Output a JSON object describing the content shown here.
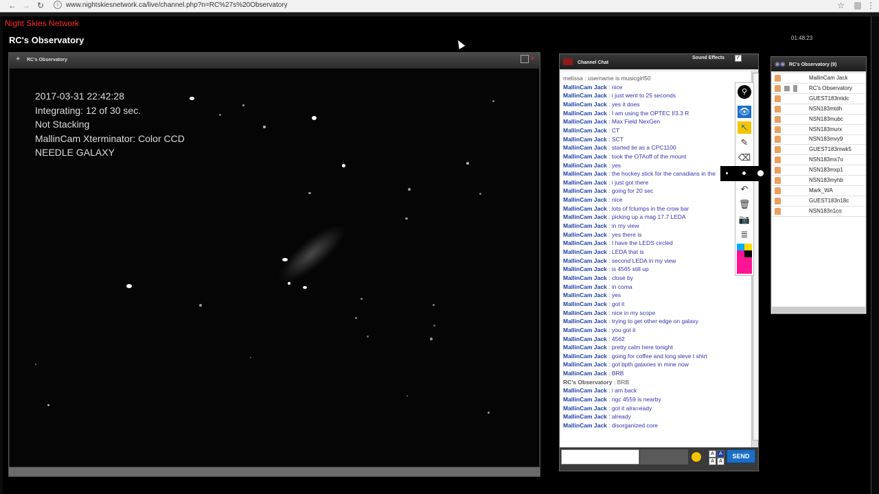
{
  "browser": {
    "url": "www.nightskiesnetwork.ca/live/channel.php?n=RC%27s%20Observatory",
    "back": "←",
    "forward": "→",
    "reload": "↻",
    "star": "☆",
    "menu": "⋮",
    "info": "i"
  },
  "site": {
    "name": "Night Skies Network"
  },
  "page": {
    "title": "RC's Observatory",
    "clock": "01:48:23"
  },
  "video": {
    "panel_title": "RC's Observatory",
    "overlay": {
      "line1": "2017-03-31 22:42:28",
      "line2": "Integrating: 12 of 30 sec.",
      "line3": "Not Stacking",
      "line4": "MallinCam Xterminator: Color CCD",
      "line5": "NEEDLE GALAXY"
    }
  },
  "chat": {
    "title": "Channel Chat",
    "sound_effects_label": "Sound Effects",
    "sound_effects_checked": "✓",
    "send_label": "SEND",
    "input_value": "",
    "messages": [
      {
        "who": "melissa",
        "text": "username is musicgirl50"
      },
      {
        "who": "MallinCam Jack",
        "text": "nice"
      },
      {
        "who": "MallinCam Jack",
        "text": "i just went to 25 seconds"
      },
      {
        "who": "MallinCam Jack",
        "text": "yes it does"
      },
      {
        "who": "MallinCam Jack",
        "text": "I am using the OPTEC f/3.3 R"
      },
      {
        "who": "MallinCam Jack",
        "text": "Max Field NexGen"
      },
      {
        "who": "MallinCam Jack",
        "text": "CT"
      },
      {
        "who": "MallinCam Jack",
        "text": "SCT"
      },
      {
        "who": "MallinCam Jack",
        "text": "started lie as a CPC1100"
      },
      {
        "who": "MallinCam Jack",
        "text": "took the OTAoff of the mount"
      },
      {
        "who": "MallinCam Jack",
        "text": "yes"
      },
      {
        "who": "MallinCam Jack",
        "text": "the hockey stick for the canadians in the"
      },
      {
        "who": "MallinCam Jack",
        "text": "i just got there"
      },
      {
        "who": "MallinCam Jack",
        "text": "going for 20 sec"
      },
      {
        "who": "MallinCam Jack",
        "text": "nice"
      },
      {
        "who": "MallinCam Jack",
        "text": "lots of fclumps in the crow bar"
      },
      {
        "who": "MallinCam Jack",
        "text": "picking up a mag 17.7 LEDA"
      },
      {
        "who": "MallinCam Jack",
        "text": "in my view"
      },
      {
        "who": "MallinCam Jack",
        "text": "yes there is"
      },
      {
        "who": "MallinCam Jack",
        "text": "I have the LEDS circled"
      },
      {
        "who": "MallinCam Jack",
        "text": "LEDA that is"
      },
      {
        "who": "MallinCam Jack",
        "text": "second LEDA in my view"
      },
      {
        "who": "MallinCam Jack",
        "text": "is 4565 still up"
      },
      {
        "who": "MallinCam Jack",
        "text": "close by"
      },
      {
        "who": "MallinCam Jack",
        "text": "in coma"
      },
      {
        "who": "MallinCam Jack",
        "text": "yes"
      },
      {
        "who": "MallinCam Jack",
        "text": "got it"
      },
      {
        "who": "MallinCam Jack",
        "text": "nice in my scope"
      },
      {
        "who": "MallinCam Jack",
        "text": "trying to get other edge on galaxy"
      },
      {
        "who": "MallinCam Jack",
        "text": "you got it"
      },
      {
        "who": "MallinCam Jack",
        "text": "4562"
      },
      {
        "who": "MallinCam Jack",
        "text": "pretty calm here tonight"
      },
      {
        "who": "MallinCam Jack",
        "text": "going for coffee and long sleve t shirt"
      },
      {
        "who": "MallinCam Jack",
        "text": "got bpth galaxies in mine now"
      },
      {
        "who": "MallinCam Jack",
        "text": "BRB"
      },
      {
        "who": "RC's Observatory",
        "text": "BRB"
      },
      {
        "who": "MallinCam Jack",
        "text": "i am back"
      },
      {
        "who": "MallinCam Jack",
        "text": "ngc 4559 is nearby"
      },
      {
        "who": "MallinCam Jack",
        "text": "got it alra=eady"
      },
      {
        "who": "MallinCam Jack",
        "text": "already"
      },
      {
        "who": "MallinCam Jack",
        "text": "disorganized core"
      }
    ]
  },
  "toolbar": {
    "logo": "⚲",
    "eye": "👁",
    "select": "↖",
    "pencil": "✎",
    "eraser": "⌫",
    "undo": "↶",
    "trash": "🗑",
    "camera": "📷",
    "notes": "≣",
    "colors": [
      "#00aaff",
      "#ffdd00",
      "#ff1493",
      "#000000"
    ]
  },
  "users": {
    "title": "RC's Observatory (9)",
    "list": [
      "MallinCam Jack",
      "RC's Observatory",
      "GUEST183mtdc",
      "NSN183mtdh",
      "NSN183mubc",
      "NSN183murx",
      "NSN183mvy9",
      "GUEST183mwk5",
      "NSN183mx7o",
      "NSN183mxp1",
      "NSN183myhb",
      "Mark_WA",
      "GUEST183n18c",
      "NSN183n1co"
    ]
  }
}
